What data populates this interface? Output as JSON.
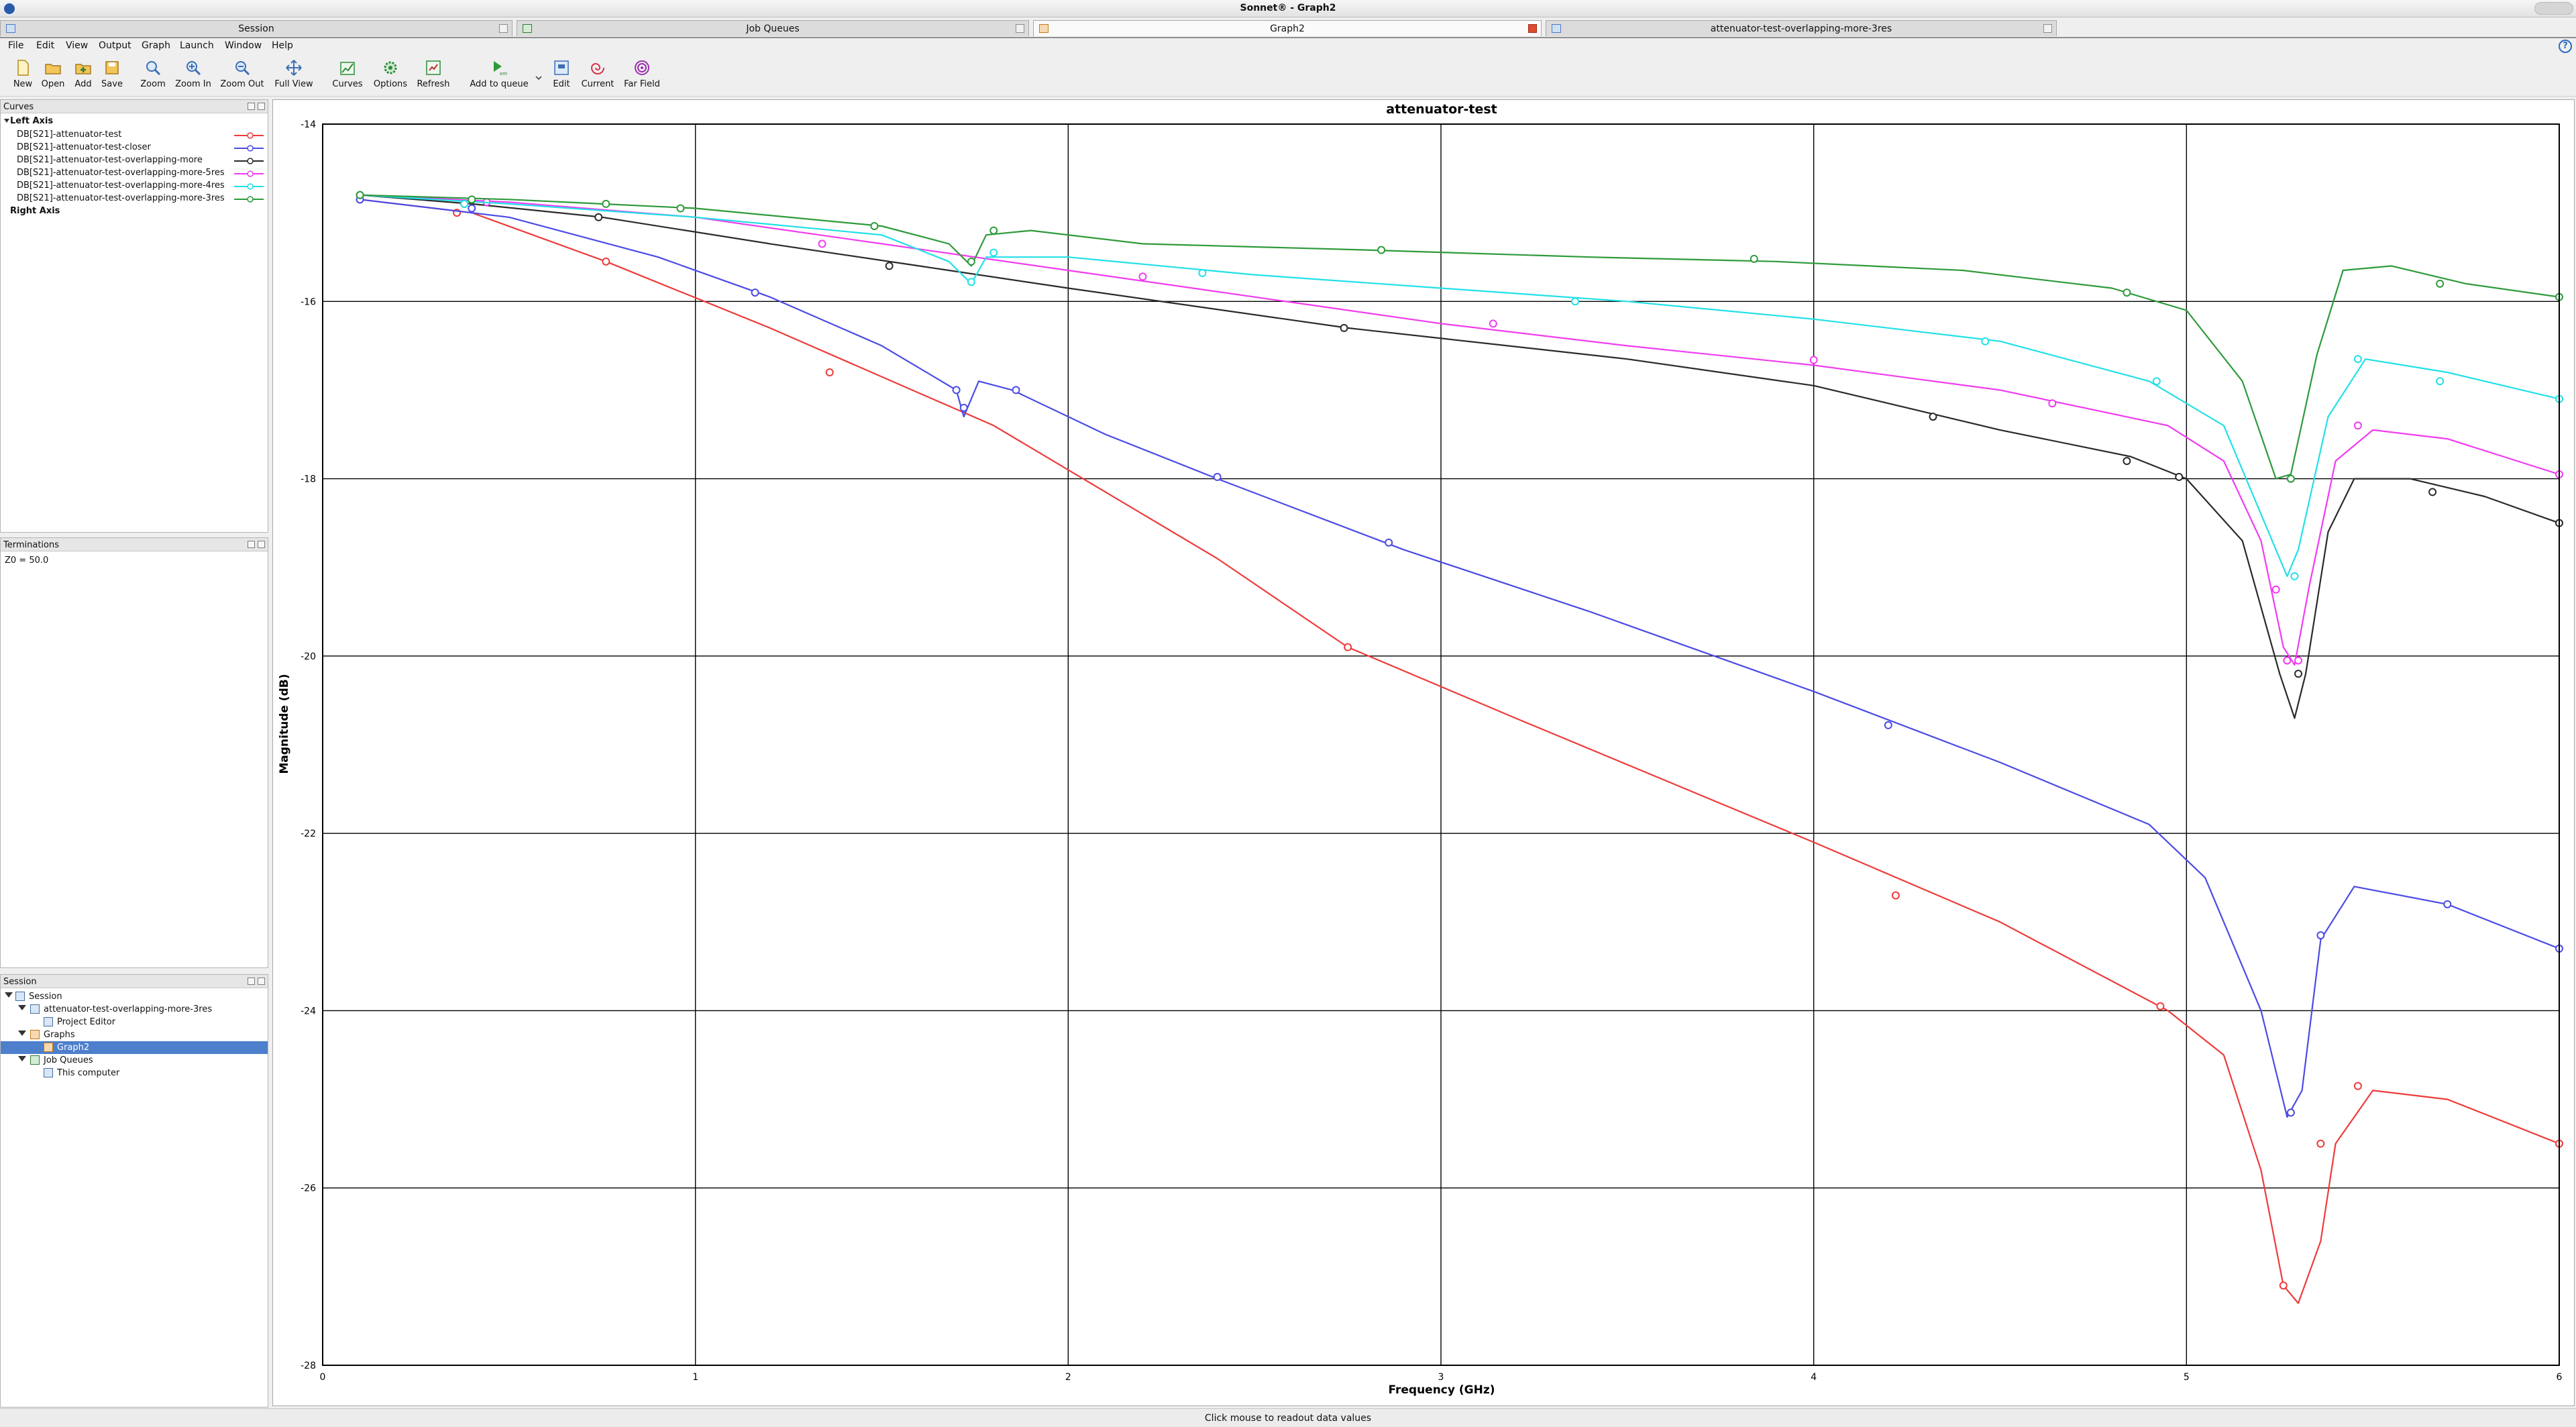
{
  "window": {
    "title": "Sonnet® - Graph2"
  },
  "tabs": [
    {
      "label": "Session",
      "active": false
    },
    {
      "label": "Job Queues",
      "active": false
    },
    {
      "label": "Graph2",
      "active": true
    },
    {
      "label": "attenuator-test-overlapping-more-3res",
      "active": false
    }
  ],
  "menu": [
    "File",
    "Edit",
    "View",
    "Output",
    "Graph",
    "Launch",
    "Window",
    "Help"
  ],
  "toolbar": [
    {
      "label": "New",
      "icon": "new-file-icon"
    },
    {
      "label": "Open",
      "icon": "folder-open-icon"
    },
    {
      "label": "Add",
      "icon": "add-icon"
    },
    {
      "label": "Save",
      "icon": "save-icon"
    },
    {
      "label": "Zoom",
      "icon": "zoom-icon"
    },
    {
      "label": "Zoom In",
      "icon": "zoom-in-icon"
    },
    {
      "label": "Zoom Out",
      "icon": "zoom-out-icon"
    },
    {
      "label": "Full View",
      "icon": "full-view-icon"
    },
    {
      "label": "Curves",
      "icon": "curves-icon"
    },
    {
      "label": "Options",
      "icon": "options-icon"
    },
    {
      "label": "Refresh",
      "icon": "refresh-icon"
    },
    {
      "label": "Add to queue",
      "icon": "add-to-queue-icon"
    },
    {
      "label": "Edit",
      "icon": "edit-icon"
    },
    {
      "label": "Current",
      "icon": "current-icon"
    },
    {
      "label": "Far Field",
      "icon": "far-field-icon"
    }
  ],
  "panels": {
    "curves": {
      "title": "Curves",
      "left_axis_label": "Left Axis",
      "right_axis_label": "Right Axis",
      "items": [
        {
          "name": "DB[S21]-attenuator-test",
          "color": "#ee3b3b"
        },
        {
          "name": "DB[S21]-attenuator-test-closer",
          "color": "#4b4be6"
        },
        {
          "name": "DB[S21]-attenuator-test-overlapping-more",
          "color": "#2a2a2a"
        },
        {
          "name": "DB[S21]-attenuator-test-overlapping-more-5res",
          "color": "#f03cf0"
        },
        {
          "name": "DB[S21]-attenuator-test-overlapping-more-4res",
          "color": "#22e0e8"
        },
        {
          "name": "DB[S21]-attenuator-test-overlapping-more-3res",
          "color": "#2e9a3a"
        }
      ]
    },
    "terminations": {
      "title": "Terminations",
      "value": "Z0 = 50.0"
    },
    "session": {
      "title": "Session",
      "tree": [
        {
          "label": "Session",
          "level": 0,
          "expanded": true,
          "selected": false
        },
        {
          "label": "attenuator-test-overlapping-more-3res",
          "level": 1,
          "expanded": true,
          "selected": false
        },
        {
          "label": "Project Editor",
          "level": 2,
          "expanded": false,
          "selected": false
        },
        {
          "label": "Graphs",
          "level": 1,
          "expanded": true,
          "selected": false
        },
        {
          "label": "Graph2",
          "level": 2,
          "expanded": false,
          "selected": true
        },
        {
          "label": "Job Queues",
          "level": 1,
          "expanded": true,
          "selected": false
        },
        {
          "label": "This computer",
          "level": 2,
          "expanded": false,
          "selected": false
        }
      ]
    }
  },
  "status": {
    "text": "Click mouse to readout data values"
  },
  "chart_data": {
    "type": "line",
    "title": "attenuator-test",
    "xlabel": "Frequency (GHz)",
    "ylabel": "Magnitude (dB)",
    "xlim": [
      0,
      6
    ],
    "ylim": [
      -28,
      -14
    ],
    "xticks": [
      0,
      1,
      2,
      3,
      4,
      5,
      6
    ],
    "yticks": [
      -14,
      -16,
      -18,
      -20,
      -22,
      -24,
      -26,
      -28
    ],
    "grid": true,
    "legend": "none",
    "series": [
      {
        "name": "DB[S21]-attenuator-test",
        "color": "#ee3b3b",
        "points": [
          [
            0.1,
            -14.85
          ],
          [
            0.4,
            -15.0
          ],
          [
            0.76,
            -15.55
          ],
          [
            1.2,
            -16.3
          ],
          [
            1.8,
            -17.4
          ],
          [
            2.4,
            -18.9
          ],
          [
            2.75,
            -19.9
          ],
          [
            3.2,
            -20.7
          ],
          [
            3.6,
            -21.4
          ],
          [
            4.0,
            -22.1
          ],
          [
            4.5,
            -23.0
          ],
          [
            4.95,
            -24.0
          ],
          [
            5.1,
            -24.5
          ],
          [
            5.2,
            -25.8
          ],
          [
            5.26,
            -27.1
          ],
          [
            5.3,
            -27.3
          ],
          [
            5.36,
            -26.6
          ],
          [
            5.4,
            -25.5
          ],
          [
            5.5,
            -24.9
          ],
          [
            5.7,
            -25.0
          ],
          [
            6.0,
            -25.5
          ]
        ],
        "markers": [
          [
            0.1,
            -14.85
          ],
          [
            0.36,
            -15.0
          ],
          [
            0.76,
            -15.55
          ],
          [
            1.36,
            -16.8
          ],
          [
            2.75,
            -19.9
          ],
          [
            4.22,
            -22.7
          ],
          [
            4.93,
            -23.95
          ],
          [
            5.26,
            -27.1
          ],
          [
            5.36,
            -25.5
          ],
          [
            5.46,
            -24.85
          ],
          [
            6.0,
            -25.5
          ]
        ]
      },
      {
        "name": "DB[S21]-attenuator-test-closer",
        "color": "#4b4be6",
        "points": [
          [
            0.1,
            -14.85
          ],
          [
            0.5,
            -15.05
          ],
          [
            0.9,
            -15.5
          ],
          [
            1.2,
            -15.95
          ],
          [
            1.5,
            -16.5
          ],
          [
            1.7,
            -17.0
          ],
          [
            1.72,
            -17.3
          ],
          [
            1.76,
            -16.9
          ],
          [
            1.85,
            -17.0
          ],
          [
            2.1,
            -17.5
          ],
          [
            2.4,
            -18.0
          ],
          [
            2.9,
            -18.8
          ],
          [
            3.4,
            -19.5
          ],
          [
            4.0,
            -20.4
          ],
          [
            4.5,
            -21.2
          ],
          [
            4.9,
            -21.9
          ],
          [
            5.05,
            -22.5
          ],
          [
            5.2,
            -24.0
          ],
          [
            5.27,
            -25.2
          ],
          [
            5.31,
            -24.9
          ],
          [
            5.36,
            -23.2
          ],
          [
            5.45,
            -22.6
          ],
          [
            5.7,
            -22.8
          ],
          [
            6.0,
            -23.3
          ]
        ],
        "markers": [
          [
            0.1,
            -14.85
          ],
          [
            0.4,
            -14.95
          ],
          [
            1.16,
            -15.9
          ],
          [
            1.7,
            -17.0
          ],
          [
            1.72,
            -17.2
          ],
          [
            1.86,
            -17.0
          ],
          [
            2.4,
            -17.98
          ],
          [
            2.86,
            -18.72
          ],
          [
            4.2,
            -20.78
          ],
          [
            5.28,
            -25.15
          ],
          [
            5.36,
            -23.15
          ],
          [
            5.7,
            -22.8
          ],
          [
            6.0,
            -23.3
          ]
        ]
      },
      {
        "name": "DB[S21]-attenuator-test-overlapping-more",
        "color": "#2a2a2a",
        "points": [
          [
            0.1,
            -14.8
          ],
          [
            0.4,
            -14.9
          ],
          [
            0.75,
            -15.05
          ],
          [
            1.2,
            -15.35
          ],
          [
            1.6,
            -15.6
          ],
          [
            2.0,
            -15.85
          ],
          [
            2.75,
            -16.3
          ],
          [
            3.5,
            -16.65
          ],
          [
            4.0,
            -16.95
          ],
          [
            4.5,
            -17.45
          ],
          [
            4.85,
            -17.75
          ],
          [
            5.0,
            -18.0
          ],
          [
            5.15,
            -18.7
          ],
          [
            5.25,
            -20.2
          ],
          [
            5.29,
            -20.7
          ],
          [
            5.32,
            -20.2
          ],
          [
            5.38,
            -18.6
          ],
          [
            5.45,
            -18.0
          ],
          [
            5.6,
            -18.0
          ],
          [
            5.8,
            -18.2
          ],
          [
            6.0,
            -18.5
          ]
        ],
        "markers": [
          [
            0.1,
            -14.8
          ],
          [
            0.38,
            -14.9
          ],
          [
            0.74,
            -15.05
          ],
          [
            1.52,
            -15.6
          ],
          [
            2.74,
            -16.3
          ],
          [
            4.32,
            -17.3
          ],
          [
            4.84,
            -17.8
          ],
          [
            4.98,
            -17.98
          ],
          [
            5.3,
            -20.2
          ],
          [
            5.66,
            -18.15
          ],
          [
            6.0,
            -18.5
          ]
        ]
      },
      {
        "name": "DB[S21]-attenuator-test-overlapping-more-5res",
        "color": "#f03cf0",
        "points": [
          [
            0.1,
            -14.8
          ],
          [
            0.5,
            -14.88
          ],
          [
            1.0,
            -15.05
          ],
          [
            1.5,
            -15.35
          ],
          [
            2.0,
            -15.65
          ],
          [
            2.5,
            -15.95
          ],
          [
            3.0,
            -16.25
          ],
          [
            3.5,
            -16.5
          ],
          [
            4.0,
            -16.72
          ],
          [
            4.5,
            -17.0
          ],
          [
            4.95,
            -17.4
          ],
          [
            5.1,
            -17.8
          ],
          [
            5.2,
            -18.7
          ],
          [
            5.26,
            -19.9
          ],
          [
            5.29,
            -20.1
          ],
          [
            5.33,
            -19.2
          ],
          [
            5.4,
            -17.8
          ],
          [
            5.5,
            -17.45
          ],
          [
            5.7,
            -17.55
          ],
          [
            6.0,
            -17.95
          ]
        ],
        "markers": [
          [
            0.1,
            -14.8
          ],
          [
            0.44,
            -14.88
          ],
          [
            1.34,
            -15.35
          ],
          [
            2.2,
            -15.72
          ],
          [
            3.14,
            -16.25
          ],
          [
            4.0,
            -16.66
          ],
          [
            4.64,
            -17.15
          ],
          [
            5.24,
            -19.25
          ],
          [
            5.27,
            -20.05
          ],
          [
            5.3,
            -20.05
          ],
          [
            5.46,
            -17.4
          ],
          [
            6.0,
            -17.95
          ]
        ]
      },
      {
        "name": "DB[S21]-attenuator-test-overlapping-more-4res",
        "color": "#22e0e8",
        "points": [
          [
            0.1,
            -14.8
          ],
          [
            0.5,
            -14.9
          ],
          [
            1.0,
            -15.05
          ],
          [
            1.5,
            -15.25
          ],
          [
            1.68,
            -15.55
          ],
          [
            1.74,
            -15.8
          ],
          [
            1.78,
            -15.5
          ],
          [
            2.0,
            -15.5
          ],
          [
            2.5,
            -15.7
          ],
          [
            3.0,
            -15.85
          ],
          [
            3.5,
            -16.0
          ],
          [
            4.0,
            -16.2
          ],
          [
            4.5,
            -16.45
          ],
          [
            4.9,
            -16.9
          ],
          [
            5.1,
            -17.4
          ],
          [
            5.22,
            -18.6
          ],
          [
            5.27,
            -19.1
          ],
          [
            5.3,
            -18.8
          ],
          [
            5.38,
            -17.3
          ],
          [
            5.48,
            -16.65
          ],
          [
            5.7,
            -16.8
          ],
          [
            6.0,
            -17.1
          ]
        ],
        "markers": [
          [
            0.1,
            -14.8
          ],
          [
            0.38,
            -14.9
          ],
          [
            1.74,
            -15.78
          ],
          [
            1.8,
            -15.45
          ],
          [
            2.36,
            -15.68
          ],
          [
            3.36,
            -16.0
          ],
          [
            4.46,
            -16.45
          ],
          [
            4.92,
            -16.9
          ],
          [
            5.29,
            -19.1
          ],
          [
            5.46,
            -16.65
          ],
          [
            5.68,
            -16.9
          ],
          [
            6.0,
            -17.1
          ]
        ]
      },
      {
        "name": "DB[S21]-attenuator-test-overlapping-more-3res",
        "color": "#2e9a3a",
        "points": [
          [
            0.1,
            -14.8
          ],
          [
            0.5,
            -14.85
          ],
          [
            1.0,
            -14.95
          ],
          [
            1.5,
            -15.15
          ],
          [
            1.68,
            -15.35
          ],
          [
            1.74,
            -15.6
          ],
          [
            1.78,
            -15.25
          ],
          [
            1.9,
            -15.2
          ],
          [
            2.2,
            -15.35
          ],
          [
            2.8,
            -15.42
          ],
          [
            3.4,
            -15.5
          ],
          [
            3.9,
            -15.55
          ],
          [
            4.4,
            -15.65
          ],
          [
            4.8,
            -15.85
          ],
          [
            5.0,
            -16.1
          ],
          [
            5.15,
            -16.9
          ],
          [
            5.24,
            -18.0
          ],
          [
            5.28,
            -17.95
          ],
          [
            5.35,
            -16.6
          ],
          [
            5.42,
            -15.65
          ],
          [
            5.55,
            -15.6
          ],
          [
            5.75,
            -15.8
          ],
          [
            6.0,
            -15.95
          ]
        ],
        "markers": [
          [
            0.1,
            -14.8
          ],
          [
            0.4,
            -14.85
          ],
          [
            0.76,
            -14.9
          ],
          [
            0.96,
            -14.95
          ],
          [
            1.48,
            -15.15
          ],
          [
            1.74,
            -15.55
          ],
          [
            1.8,
            -15.2
          ],
          [
            2.84,
            -15.42
          ],
          [
            3.84,
            -15.52
          ],
          [
            4.84,
            -15.9
          ],
          [
            5.28,
            -18.0
          ],
          [
            5.68,
            -15.8
          ],
          [
            6.0,
            -15.95
          ]
        ]
      }
    ]
  }
}
